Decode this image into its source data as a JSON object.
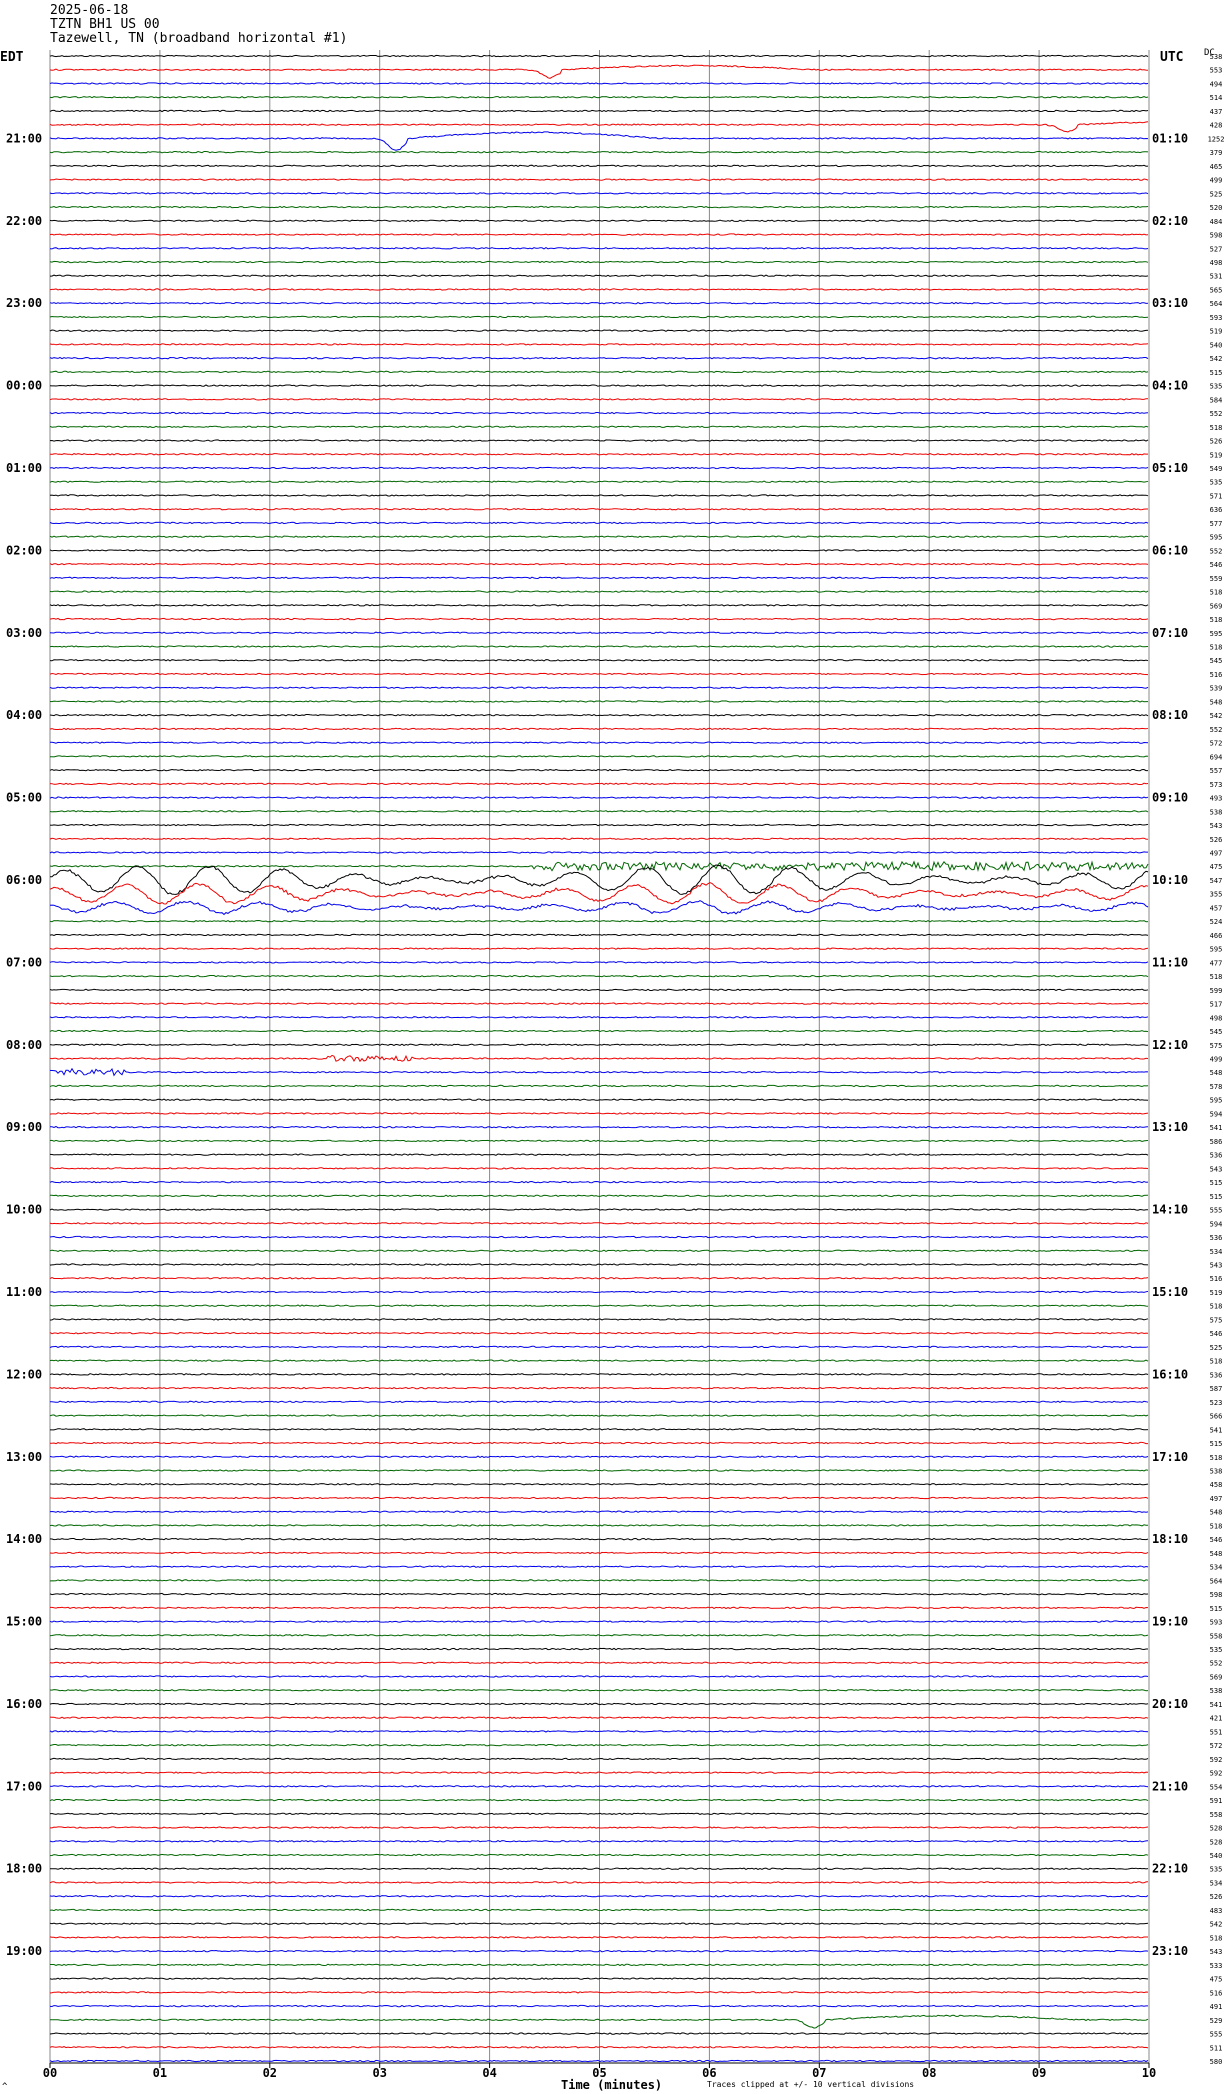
{
  "header": {
    "date": "2025-06-18",
    "station": "TZTN BH1 US 00",
    "location": "Tazewell, TN (broadband horizontal #1)"
  },
  "left_axis_title": "EDT",
  "right_axis_title": "UTC",
  "dc_title": "DC",
  "footer": {
    "xlabel": "Time (minutes)",
    "clip_note": "Traces clipped at +/- 10 vertical divisions",
    "corner_mark": "^"
  },
  "colors": [
    "#000000",
    "#ee0000",
    "#0000ee",
    "#006600"
  ],
  "chart_data": {
    "type": "line",
    "x_ticks": [
      "00",
      "01",
      "02",
      "03",
      "04",
      "05",
      "06",
      "07",
      "08",
      "09",
      "10"
    ],
    "xlim": [
      0,
      10
    ],
    "edt_labels": [
      "21:00",
      "22:00",
      "23:00",
      "00:00",
      "01:00",
      "02:00",
      "03:00",
      "04:00",
      "05:00",
      "06:00",
      "07:00",
      "08:00",
      "09:00",
      "10:00",
      "11:00",
      "12:00",
      "13:00",
      "14:00",
      "15:00",
      "16:00",
      "17:00",
      "18:00",
      "19:00"
    ],
    "utc_labels": [
      "01:10",
      "02:10",
      "03:10",
      "04:10",
      "05:10",
      "06:10",
      "07:10",
      "08:10",
      "09:10",
      "10:10",
      "11:10",
      "12:10",
      "13:10",
      "14:10",
      "15:10",
      "16:10",
      "17:10",
      "18:10",
      "19:10",
      "20:10",
      "21:10",
      "22:10",
      "23:10"
    ],
    "label_first_row": 6,
    "label_every": 6,
    "dc_values": [
      538,
      553,
      494,
      514,
      437,
      428,
      1252,
      379,
      465,
      499,
      525,
      520,
      484,
      598,
      527,
      498,
      531,
      565,
      564,
      593,
      519,
      540,
      542,
      515,
      535,
      584,
      552,
      518,
      526,
      519,
      549,
      535,
      571,
      636,
      577,
      595,
      552,
      546,
      559,
      518,
      569,
      518,
      595,
      518,
      545,
      516,
      539,
      548,
      542,
      552,
      572,
      694,
      557,
      573,
      493,
      538,
      543,
      526,
      497,
      475,
      547,
      355,
      457,
      524,
      466,
      595,
      477,
      518,
      599,
      517,
      498,
      545,
      575,
      499,
      548,
      578,
      595,
      594,
      541,
      586,
      536,
      543,
      515,
      515,
      555,
      594,
      536,
      534,
      543,
      516,
      519,
      518,
      575,
      546,
      525,
      518,
      536,
      587,
      523,
      566,
      541,
      515,
      518,
      538,
      458,
      497,
      548,
      518,
      546,
      548,
      534,
      564,
      598,
      515,
      593,
      558,
      535,
      552,
      569,
      538,
      541,
      421,
      551,
      572,
      592,
      592,
      554,
      591,
      558,
      528,
      528,
      540,
      535,
      534,
      526,
      483,
      542,
      518,
      543,
      533,
      475,
      516,
      491,
      529,
      555,
      511,
      580
    ],
    "events": [
      {
        "row": 1,
        "minute": 4.5,
        "amplitude": 8,
        "shape": "dip-rise"
      },
      {
        "row": 5,
        "minute": 9.2,
        "amplitude": 7,
        "shape": "dip-rise"
      },
      {
        "row": 6,
        "minute": 3.1,
        "amplitude": 12,
        "shape": "dip-rise"
      },
      {
        "row": 59,
        "minute": 5.0,
        "amplitude": 5,
        "shape": "noise-burst-late"
      },
      {
        "row": 60,
        "minute": 0,
        "amplitude": 14,
        "shape": "oscillation"
      },
      {
        "row": 61,
        "minute": 0,
        "amplitude": 10,
        "shape": "oscillation"
      },
      {
        "row": 62,
        "minute": 0,
        "amplitude": 6,
        "shape": "oscillation"
      },
      {
        "row": 73,
        "minute": 2.9,
        "amplitude": 3,
        "shape": "burst"
      },
      {
        "row": 74,
        "minute": 0.3,
        "amplitude": 3,
        "shape": "burst"
      },
      {
        "row": 143,
        "minute": 6.9,
        "amplitude": 8,
        "shape": "dip-rise"
      }
    ]
  }
}
